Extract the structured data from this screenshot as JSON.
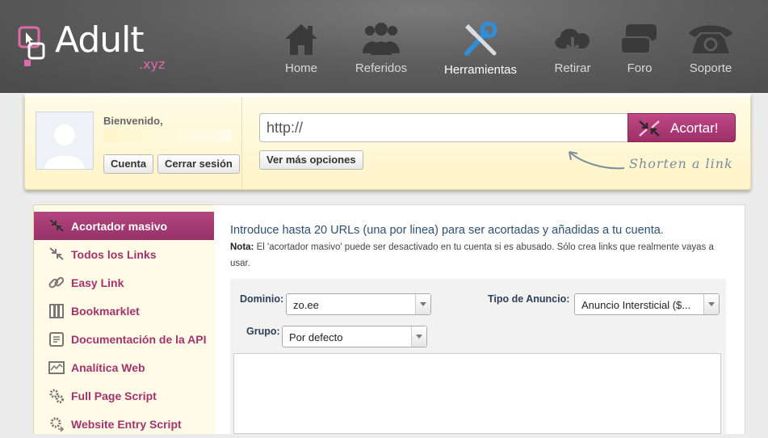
{
  "brand": {
    "name": "Adult",
    "tld": ".xyz"
  },
  "nav": [
    {
      "label": "Home",
      "icon": "home-icon"
    },
    {
      "label": "Referidos",
      "icon": "users-icon"
    },
    {
      "label": "Herramientas",
      "icon": "tools-icon",
      "active": true
    },
    {
      "label": "Retirar",
      "icon": "cloud-download-icon"
    },
    {
      "label": "Foro",
      "icon": "chat-icon"
    },
    {
      "label": "Soporte",
      "icon": "phone-icon"
    }
  ],
  "user": {
    "welcome": "Bienvenido,",
    "account_button": "Cuenta",
    "logout_button": "Cerrar sesión"
  },
  "shortener": {
    "url_value": "http://",
    "submit_label": "Acortar!",
    "more_options_label": "Ver más opciones",
    "hint": "Shorten a link"
  },
  "sidebar": {
    "items": [
      {
        "label": "Acortador masivo",
        "icon": "bulk-shorten-icon",
        "active": true
      },
      {
        "label": "Todos los Links",
        "icon": "links-icon"
      },
      {
        "label": "Easy Link",
        "icon": "chain-link-icon"
      },
      {
        "label": "Bookmarklet",
        "icon": "bookmark-icon"
      },
      {
        "label": "Documentación de la API",
        "icon": "api-doc-icon"
      },
      {
        "label": "Analítica Web",
        "icon": "analytics-icon"
      },
      {
        "label": "Full Page Script",
        "icon": "gears-icon"
      },
      {
        "label": "Website Entry Script",
        "icon": "gear-arrow-icon"
      }
    ]
  },
  "main": {
    "intro": "Introduce hasta 20 URLs (una por linea) para ser acortadas y añadidas a tu cuenta.",
    "note_label": "Nota:",
    "note_text": "El 'acortador masivo' puede ser desactivado en tu cuenta si es abusado. Sólo crea links que realmente vayas a usar.",
    "form": {
      "domain_label": "Dominio:",
      "domain_value": "zo.ee",
      "ad_type_label": "Tipo de Anuncio:",
      "ad_type_value": "Anuncio Intersticial ($...",
      "group_label": "Grupo:",
      "group_value": "Por defecto"
    }
  },
  "colors": {
    "accent": "#a3326d",
    "header_bg": "#5e5e5e",
    "panel_bg": "#fff8d6",
    "link_blue": "#2e4f73"
  }
}
